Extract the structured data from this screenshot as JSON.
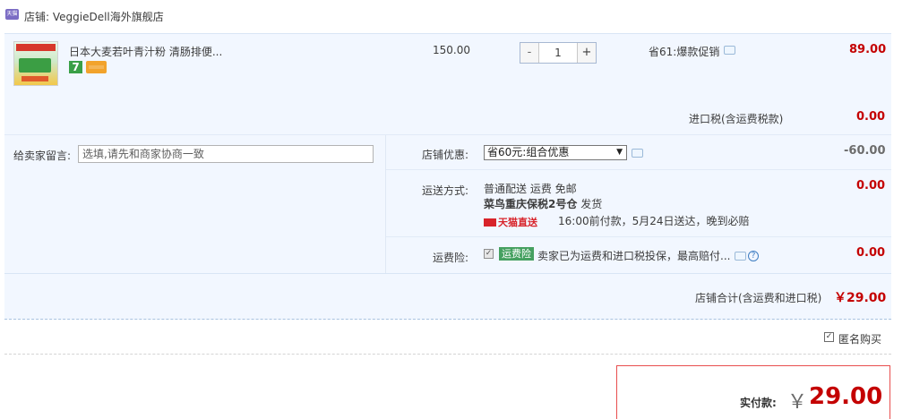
{
  "shop": {
    "icon": "tmall-icon",
    "label": "店铺: VeggieDell海外旗舰店"
  },
  "item": {
    "title": "日本大麦若叶青汁粉 清肠排便...",
    "badge_num": "7",
    "unit_price": "150.00",
    "quantity": "1",
    "minus": "-",
    "plus": "+",
    "promo": "省61:爆款促销",
    "total": "89.00"
  },
  "tax": {
    "label": "进口税(含运费税款)",
    "value": "0.00"
  },
  "message": {
    "label": "给卖家留言:",
    "placeholder": "选填,请先和商家协商一致"
  },
  "discount": {
    "label": "店铺优惠:",
    "selected": "省60元:组合优惠",
    "value": "-60.00"
  },
  "shipping": {
    "label": "运送方式:",
    "method": "普通配送 运费 免邮",
    "warehouse": "菜鸟重庆保税2号仓",
    "dispatch": "发货",
    "tmall_direct": "天猫直送",
    "eta": "16:00前付款，5月24日送达，晚到必赔",
    "value": "0.00"
  },
  "insurance": {
    "label": "运费险:",
    "badge": "运费险",
    "desc": "卖家已为运费和进口税投保，最高赔付...",
    "value": "0.00"
  },
  "subtotal": {
    "label": "店铺合计(含运费和进口税)",
    "value": "￥29.00"
  },
  "anonymous": {
    "label": "匿名购买",
    "checked": true
  },
  "payment": {
    "label": "实付款:",
    "currency": "￥",
    "value": "29.00"
  },
  "colors": {
    "accent_red": "#c40000",
    "row_bg": "#f2f7ff",
    "insurance_green": "#45a060"
  }
}
